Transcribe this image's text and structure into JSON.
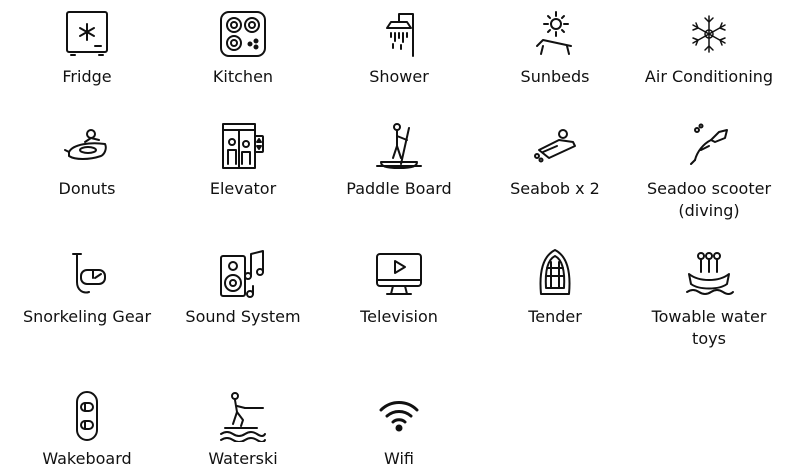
{
  "amenities": [
    {
      "label": "Fridge",
      "icon": "fridge-icon"
    },
    {
      "label": "Kitchen",
      "icon": "stove-icon"
    },
    {
      "label": "Shower",
      "icon": "shower-icon"
    },
    {
      "label": "Sunbeds",
      "icon": "sunbed-icon"
    },
    {
      "label": "Air Conditioning",
      "icon": "snowflake-icon"
    },
    {
      "label": "Donuts",
      "icon": "donut-tube-icon"
    },
    {
      "label": "Elevator",
      "icon": "elevator-icon"
    },
    {
      "label": "Paddle Board",
      "icon": "paddle-board-icon"
    },
    {
      "label": "Seabob x 2",
      "icon": "seabob-icon"
    },
    {
      "label": "Seadoo scooter\n(diving)",
      "icon": "seadoo-scooter-icon"
    },
    {
      "label": "Snorkeling Gear",
      "icon": "snorkel-mask-icon"
    },
    {
      "label": "Sound System",
      "icon": "speaker-music-icon"
    },
    {
      "label": "Television",
      "icon": "television-icon"
    },
    {
      "label": "Tender",
      "icon": "tender-boat-icon"
    },
    {
      "label": "Towable water\ntoys",
      "icon": "towable-toy-icon"
    },
    {
      "label": "Wakeboard",
      "icon": "wakeboard-icon"
    },
    {
      "label": "Waterski",
      "icon": "waterski-icon"
    },
    {
      "label": "Wifi",
      "icon": "wifi-icon"
    }
  ]
}
